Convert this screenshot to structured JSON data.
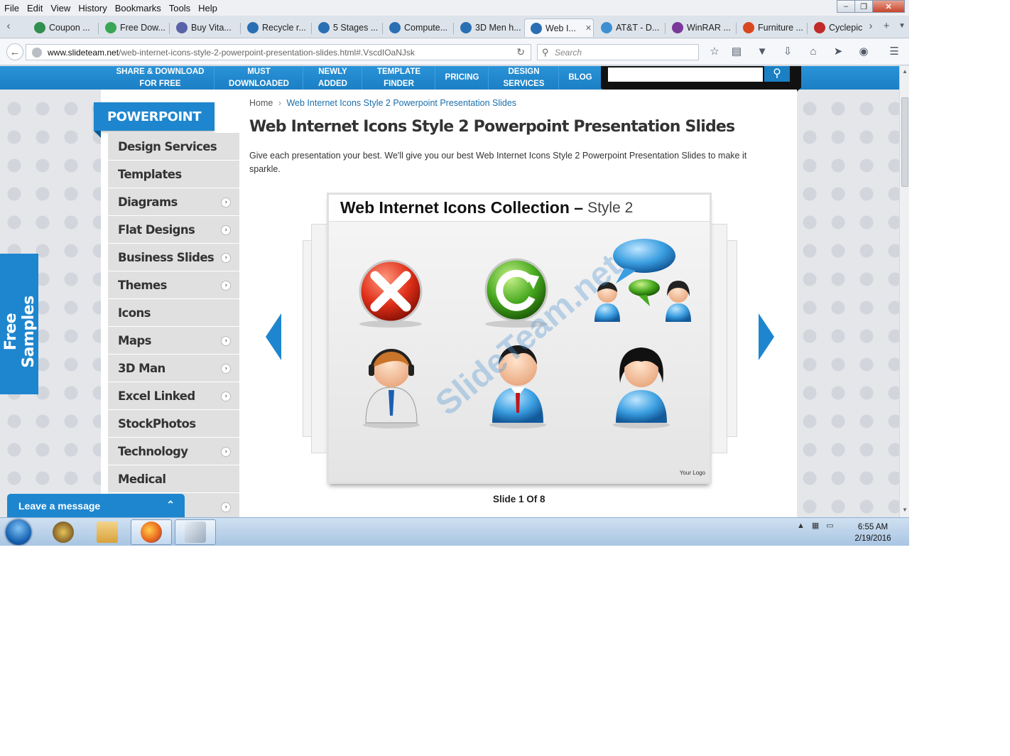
{
  "browser": {
    "menu": [
      "File",
      "Edit",
      "View",
      "History",
      "Bookmarks",
      "Tools",
      "Help"
    ],
    "tabs": [
      {
        "label": "Coupon ...",
        "color": "#2f8f4e"
      },
      {
        "label": "Free Dow...",
        "color": "#3aa655"
      },
      {
        "label": "Buy Vita...",
        "color": "#5a63a8"
      },
      {
        "label": "Recycle r...",
        "color": "#2a6fb3"
      },
      {
        "label": "5 Stages ...",
        "color": "#2a6fb3"
      },
      {
        "label": "Compute...",
        "color": "#2a6fb3"
      },
      {
        "label": "3D Men h...",
        "color": "#2a6fb3"
      },
      {
        "label": "Web I...",
        "color": "#2a6fb3",
        "active": true
      },
      {
        "label": "AT&T - D...",
        "color": "#3d8fd1"
      },
      {
        "label": "WinRAR ...",
        "color": "#7b3a9a"
      },
      {
        "label": "Furniture ...",
        "color": "#d9471f"
      },
      {
        "label": "Cyclepic",
        "color": "#c02a2a"
      }
    ],
    "url_domain": "www.slideteam.net",
    "url_path": "/web-internet-icons-style-2-powerpoint-presentation-slides.html#.VscdIOaNJsk",
    "search_placeholder": "Search"
  },
  "site": {
    "topnav": [
      {
        "l1": "SHARE & DOWNLOAD",
        "l2": "FOR FREE"
      },
      {
        "l1": "MUST",
        "l2": "DOWNLOADED"
      },
      {
        "l1": "NEWLY",
        "l2": "ADDED"
      },
      {
        "l1": "TEMPLATE",
        "l2": "FINDER"
      },
      {
        "l1": "PRICING",
        "l2": ""
      },
      {
        "l1": "DESIGN",
        "l2": "SERVICES"
      },
      {
        "l1": "BLOG",
        "l2": ""
      }
    ],
    "sidebar_title": "POWERPOINT",
    "sidebar": [
      {
        "label": "Design Services",
        "arrow": false
      },
      {
        "label": "Templates",
        "arrow": false
      },
      {
        "label": "Diagrams",
        "arrow": true
      },
      {
        "label": "Flat Designs",
        "arrow": true
      },
      {
        "label": "Business Slides",
        "arrow": true
      },
      {
        "label": "Themes",
        "arrow": true
      },
      {
        "label": "Icons",
        "arrow": false
      },
      {
        "label": "Maps",
        "arrow": true
      },
      {
        "label": "3D Man",
        "arrow": true
      },
      {
        "label": "Excel Linked",
        "arrow": true
      },
      {
        "label": "StockPhotos",
        "arrow": false
      },
      {
        "label": "Technology",
        "arrow": true
      },
      {
        "label": "Medical",
        "arrow": false
      },
      {
        "label": "",
        "arrow": true
      }
    ],
    "breadcrumb_home": "Home",
    "breadcrumb_current": "Web Internet Icons Style 2 Powerpoint Presentation Slides",
    "page_title": "Web Internet Icons Style 2 Powerpoint Presentation Slides",
    "page_desc": "Give each presentation your best. We'll give you our best Web Internet Icons Style 2 Powerpoint Presentation Slides to make it sparkle.",
    "slide": {
      "title_bold": "Web  Internet Icons Collection –",
      "title_rest": "Style 2",
      "watermark": "SlideTeam.net",
      "logo": "Your Logo",
      "caption": "Slide 1 Of 8"
    },
    "free_samples": "Free Samples",
    "leave_message": "Leave a message"
  },
  "taskbar": {
    "time": "6:55 AM",
    "date": "2/19/2016"
  }
}
